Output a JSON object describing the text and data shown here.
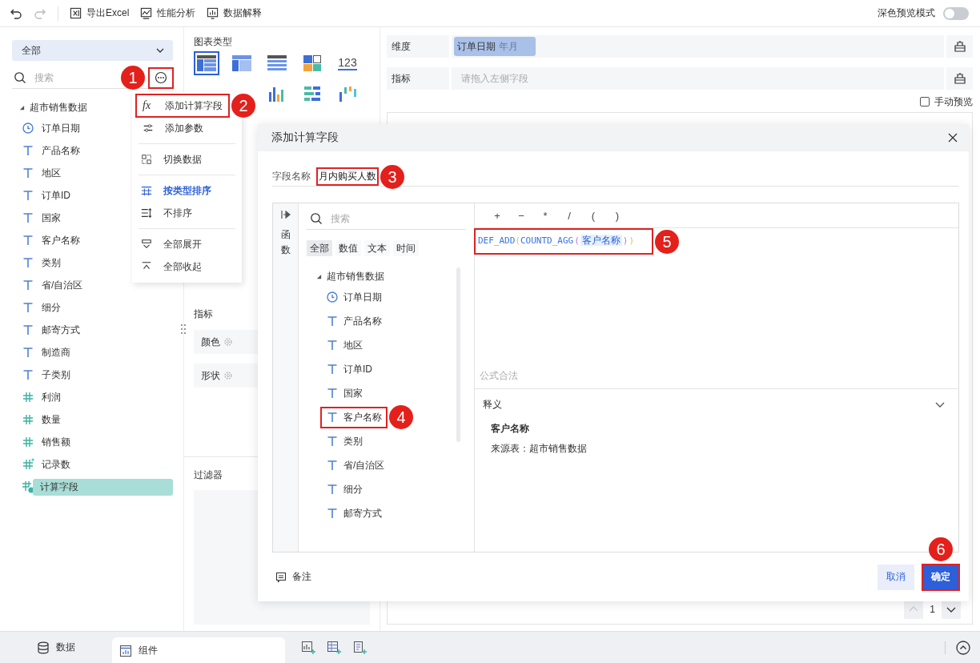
{
  "toolbar": {
    "history": [
      {
        "kind": "undo",
        "disabled": false
      },
      {
        "kind": "redo",
        "disabled": true
      }
    ],
    "actions": [
      {
        "kind": "excel",
        "label": "导出Excel"
      },
      {
        "kind": "performance",
        "label": "性能分析"
      },
      {
        "kind": "explain",
        "label": "数据解释"
      }
    ],
    "dark_mode": {
      "label": "深色预览模式",
      "on": false
    }
  },
  "data_panel": {
    "source": "全部",
    "search": {
      "placeholder": "搜索"
    },
    "more_button": {
      "marker": "1"
    },
    "tree": [
      {
        "label": "超市销售数据",
        "expanded": true,
        "children": [
          {
            "label": "订单日期",
            "kind": "date",
            "selected": false
          },
          {
            "label": "产品名称",
            "kind": "text",
            "selected": false
          },
          {
            "label": "地区",
            "kind": "text",
            "selected": false
          },
          {
            "label": "订单ID",
            "kind": "text",
            "selected": false
          },
          {
            "label": "国家",
            "kind": "text",
            "selected": false
          },
          {
            "label": "客户名称",
            "kind": "text",
            "selected": false
          },
          {
            "label": "类别",
            "kind": "text",
            "selected": false
          },
          {
            "label": "省/自治区",
            "kind": "text",
            "selected": false
          },
          {
            "label": "细分",
            "kind": "text",
            "selected": false
          },
          {
            "label": "邮寄方式",
            "kind": "text",
            "selected": false
          },
          {
            "label": "制造商",
            "kind": "text",
            "selected": false
          },
          {
            "label": "子类别",
            "kind": "text",
            "selected": false
          },
          {
            "label": "利润",
            "kind": "number",
            "selected": false
          },
          {
            "label": "数量",
            "kind": "number",
            "selected": false
          },
          {
            "label": "销售额",
            "kind": "number",
            "selected": false
          },
          {
            "label": "记录数",
            "kind": "count",
            "selected": false
          },
          {
            "label": "计算字段",
            "kind": "calc",
            "selected": true
          }
        ]
      }
    ]
  },
  "field_menu": {
    "groups": [
      {
        "items": [
          {
            "kind": "formula",
            "glyph": "fx",
            "label": "添加计算字段",
            "marker": "2"
          },
          {
            "kind": "parameter",
            "label": "添加参数"
          }
        ]
      },
      {
        "items": [
          {
            "kind": "switch",
            "label": "切换数据"
          }
        ]
      },
      {
        "items": [
          {
            "kind": "sort-type",
            "label": "按类型排序",
            "selected": true
          },
          {
            "kind": "no-sort",
            "label": "不排序",
            "selected": false
          }
        ]
      },
      {
        "items": [
          {
            "kind": "expand",
            "label": "全部展开"
          },
          {
            "kind": "collapse",
            "label": "全部收起"
          }
        ]
      }
    ]
  },
  "chart_panel": {
    "title": "图表类型",
    "chart_types": [
      {
        "kind": "table",
        "selected": true
      },
      {
        "kind": "cross-table",
        "selected": false
      },
      {
        "kind": "detail-table",
        "selected": false
      },
      {
        "kind": "treemap",
        "selected": false
      },
      {
        "kind": "kpi",
        "label": "123",
        "selected": false
      },
      {
        "kind": "bar",
        "selected": false
      },
      {
        "kind": "bar-table",
        "selected": false
      },
      {
        "kind": "waterfall",
        "selected": false
      }
    ],
    "measure_title": "指标",
    "slots": [
      {
        "label": "颜色"
      },
      {
        "label": "形状"
      }
    ],
    "filter_title": "过滤器"
  },
  "design": {
    "dimension": {
      "label": "维度",
      "pill": {
        "field": "订单日期",
        "suffix": "年月"
      }
    },
    "measure": {
      "label": "指标",
      "placeholder": "请拖入左侧字段"
    },
    "manual_preview": {
      "label": "手动预览",
      "checked": false
    },
    "pager": {
      "page": "1",
      "prev_disabled": true
    }
  },
  "dialog": {
    "title": "添加计算字段",
    "name_label": "字段名称",
    "name_value": "月内购买人数",
    "name_marker": "3",
    "side_tab": "函数",
    "search": {
      "placeholder": "搜索"
    },
    "filters": [
      {
        "label": "全部",
        "selected": true
      },
      {
        "label": "数值",
        "selected": false
      },
      {
        "label": "文本",
        "selected": false
      },
      {
        "label": "时间",
        "selected": false
      }
    ],
    "tree": [
      {
        "label": "超市销售数据",
        "expanded": true,
        "children": [
          {
            "label": "订单日期",
            "kind": "date"
          },
          {
            "label": "产品名称",
            "kind": "text"
          },
          {
            "label": "地区",
            "kind": "text"
          },
          {
            "label": "订单ID",
            "kind": "text"
          },
          {
            "label": "国家",
            "kind": "text"
          },
          {
            "label": "客户名称",
            "kind": "text",
            "marker": "4"
          },
          {
            "label": "类别",
            "kind": "text"
          },
          {
            "label": "省/自治区",
            "kind": "text"
          },
          {
            "label": "细分",
            "kind": "text"
          },
          {
            "label": "邮寄方式",
            "kind": "text"
          }
        ]
      }
    ],
    "operators": [
      "+",
      "−",
      "*",
      "/",
      "(",
      ")"
    ],
    "formula": {
      "marker": "5",
      "tokens": [
        {
          "text": "DEF_ADD",
          "kind": "function"
        },
        {
          "text": "(",
          "kind": "paren-outer"
        },
        {
          "text": "COUNTD_AGG",
          "kind": "function"
        },
        {
          "text": "(",
          "kind": "paren-inner"
        },
        {
          "text": "客户名称",
          "kind": "field"
        },
        {
          "text": ")",
          "kind": "paren-inner"
        },
        {
          "text": ")",
          "kind": "paren-outer"
        }
      ]
    },
    "status": "公式合法",
    "definition": {
      "title": "释义",
      "expanded": true,
      "field": "客户名称",
      "source": "来源表：超市销售数据"
    },
    "note": "备注",
    "buttons": [
      {
        "label": "取消",
        "kind": "secondary"
      },
      {
        "label": "确定",
        "kind": "primary",
        "marker": "6"
      }
    ]
  },
  "bottom_bar": {
    "tabs": [
      {
        "label": "数据",
        "kind": "data",
        "selected": false
      },
      {
        "label": "组件",
        "kind": "component",
        "selected": true
      }
    ]
  }
}
